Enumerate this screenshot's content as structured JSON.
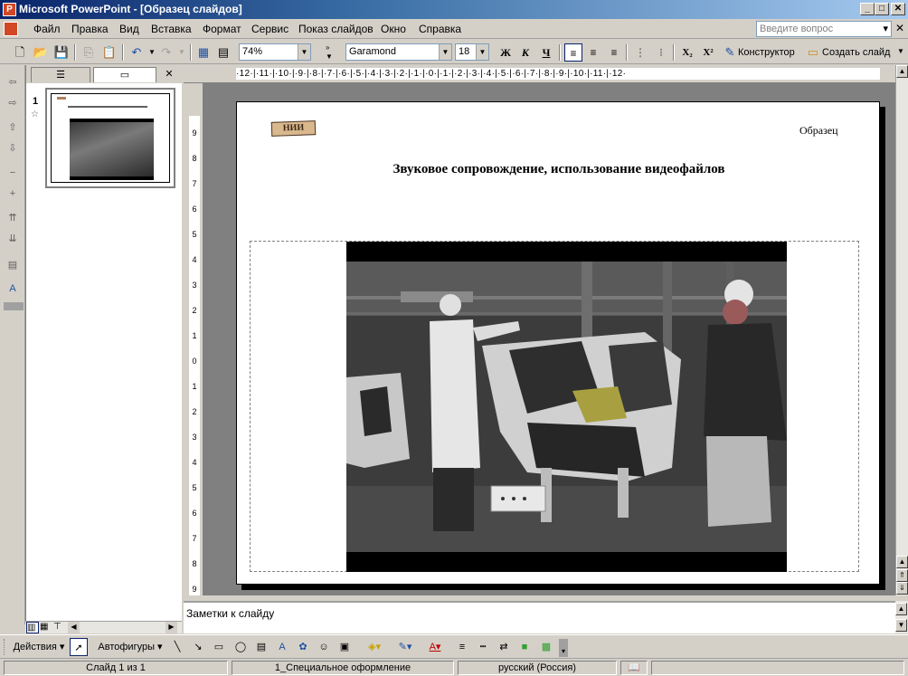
{
  "window": {
    "title": "Microsoft PowerPoint - [Образец слайдов]",
    "minimize": "_",
    "maximize": "□",
    "close": "✕"
  },
  "menu": {
    "items": [
      "Файл",
      "Правка",
      "Вид",
      "Вставка",
      "Формат",
      "Сервис",
      "Показ слайдов",
      "Окно",
      "Справка"
    ],
    "help_placeholder": "Введите вопрос"
  },
  "toolbar": {
    "zoom": "74%",
    "font": "Garamond",
    "font_size": "18",
    "bold": "Ж",
    "italic": "К",
    "underline": "Ч",
    "designer_label": "Конструктор",
    "new_slide_label": "Создать слайд"
  },
  "slide_pane": {
    "slide_number": "1"
  },
  "ruler": {
    "horizontal": "·12·|·11·|·10·|·9·|·8·|·7·|·6·|·5·|·4·|·3·|·2·|·1·|·0·|·1·|·2·|·3·|·4·|·5·|·6·|·7·|·8·|·9·|·10·|·11·|·12·",
    "vertical_ticks": [
      "9",
      "8",
      "7",
      "6",
      "5",
      "4",
      "3",
      "2",
      "1",
      "0",
      "1",
      "2",
      "3",
      "4",
      "5",
      "6",
      "7",
      "8",
      "9"
    ]
  },
  "slide": {
    "logo_text": "НИИ",
    "label": "Образец",
    "title": "Звуковое сопровождение, использование видеофайлов"
  },
  "notes": {
    "placeholder": "Заметки к слайду"
  },
  "drawing_toolbar": {
    "actions": "Действия",
    "autoshapes": "Автофигуры"
  },
  "status": {
    "slide_info": "Слайд 1 из 1",
    "design": "1_Специальное оформление",
    "language": "русский (Россия)"
  },
  "colors": {
    "title_bar": "#0a246a",
    "chrome": "#d4d0c8",
    "workspace": "#808080"
  }
}
